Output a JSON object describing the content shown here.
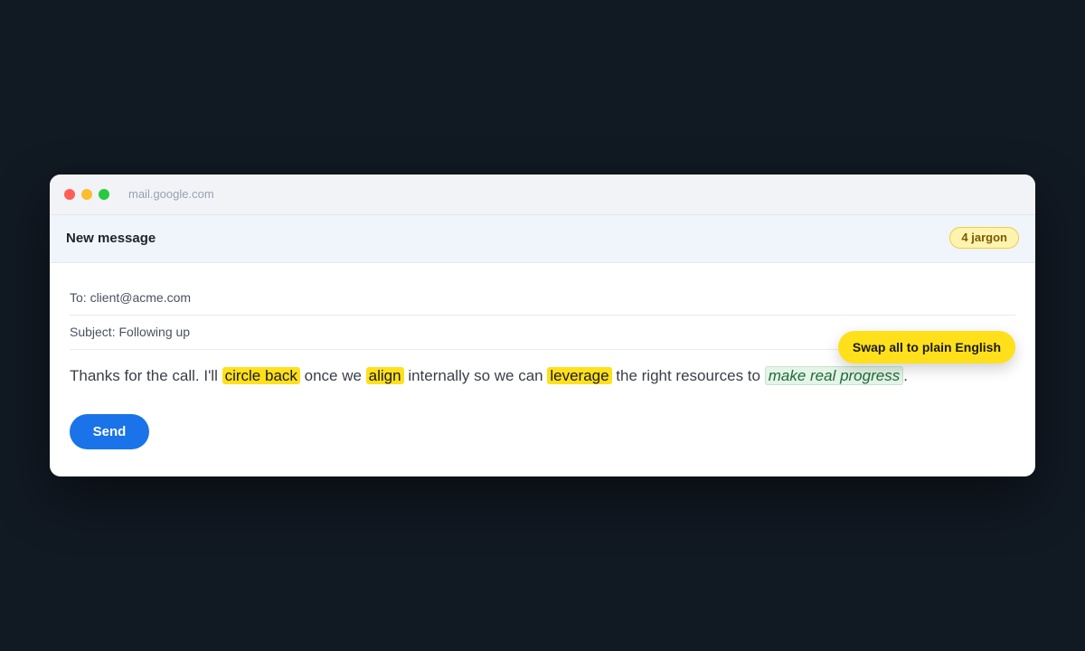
{
  "window": {
    "url": "mail.google.com"
  },
  "compose": {
    "title": "New message",
    "jargon_badge": "4 jargon",
    "to_field": "To: client@acme.com",
    "subject_field": "Subject: Following up",
    "body": {
      "seg1": "Thanks for the call. I'll ",
      "jargon1": "circle back",
      "seg2": " once we ",
      "jargon2": "align",
      "seg3": " internally so we can ",
      "jargon3": "leverage",
      "seg4": " the right resources to ",
      "replaced1": "make real progress",
      "seg5": "."
    },
    "swap_button_label": "Swap all to plain English",
    "send_label": "Send"
  },
  "colors": {
    "background": "#111923",
    "jargon_highlight": "#ffe01b",
    "replaced_highlight": "#e4f4e8",
    "send_button": "#1a73e8"
  }
}
